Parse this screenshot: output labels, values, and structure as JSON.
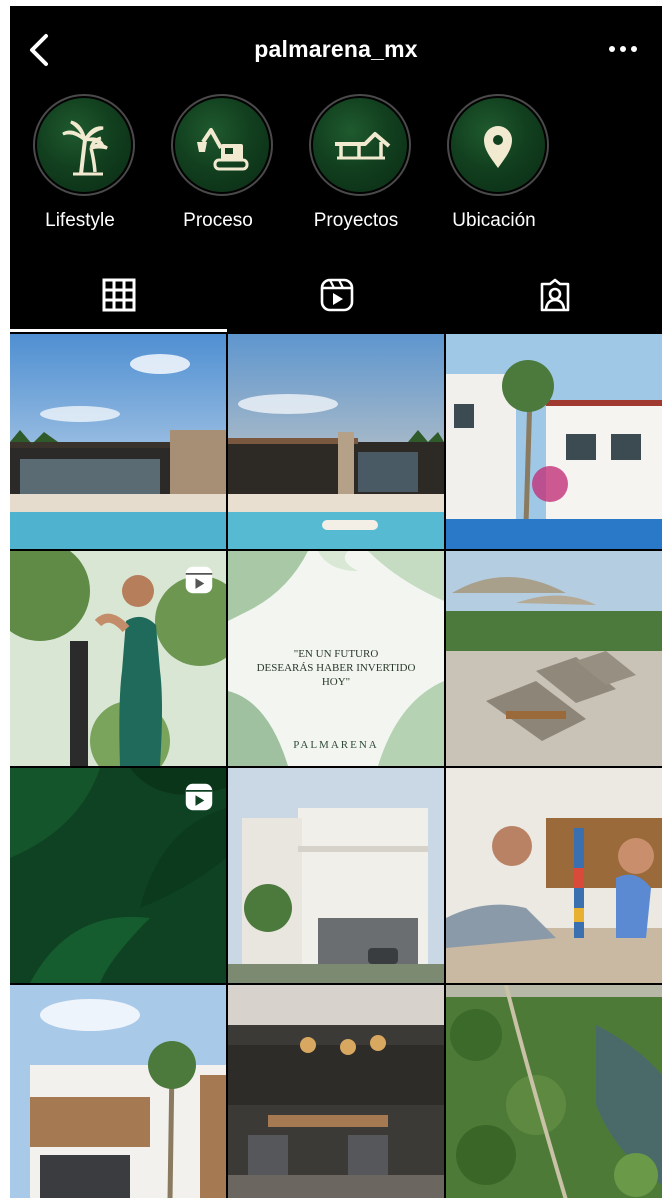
{
  "header": {
    "username": "palmarena_mx",
    "back_icon": "chevron-left-icon",
    "more_icon": "more-horizontal-icon"
  },
  "highlights": [
    {
      "label": "Lifestyle",
      "icon": "palm-tree-icon"
    },
    {
      "label": "Proceso",
      "icon": "excavator-icon"
    },
    {
      "label": "Proyectos",
      "icon": "house-roof-icon"
    },
    {
      "label": "Ubicación",
      "icon": "map-pin-icon"
    }
  ],
  "tabs": [
    {
      "name": "posts-grid",
      "icon": "grid-icon",
      "selected": true
    },
    {
      "name": "reels",
      "icon": "reels-icon",
      "selected": false
    },
    {
      "name": "tagged",
      "icon": "tagged-person-icon",
      "selected": false
    }
  ],
  "posts": [
    {
      "scene": "modern house with pool at sunset",
      "is_reel": false
    },
    {
      "scene": "modern house with pool and woman on float",
      "is_reel": false
    },
    {
      "scene": "white villas with palm trees and pool",
      "is_reel": false
    },
    {
      "scene": "woman exercising on elliptical outdoors",
      "is_reel": true
    },
    {
      "scene": "quote card with leaves",
      "is_reel": false,
      "quote_line1": "\"EN UN FUTURO",
      "quote_line2": "DESEARÁS HABER INVERTIDO HOY\"",
      "brand": "PALMARENA"
    },
    {
      "scene": "lounge chairs and umbrellas by the sea",
      "is_reel": false
    },
    {
      "scene": "green leaves close-up",
      "is_reel": true
    },
    {
      "scene": "white modern two-story house",
      "is_reel": false
    },
    {
      "scene": "father and son stacking blocks",
      "is_reel": false
    },
    {
      "scene": "white house with wood slats and palm",
      "is_reel": false
    },
    {
      "scene": "restaurant interior with pendant lamps",
      "is_reel": false
    },
    {
      "scene": "aerial view of lagoon and forest",
      "is_reel": false
    }
  ],
  "colors": {
    "background": "#000000",
    "highlight_fill": "#12401f",
    "text": "#ffffff"
  }
}
